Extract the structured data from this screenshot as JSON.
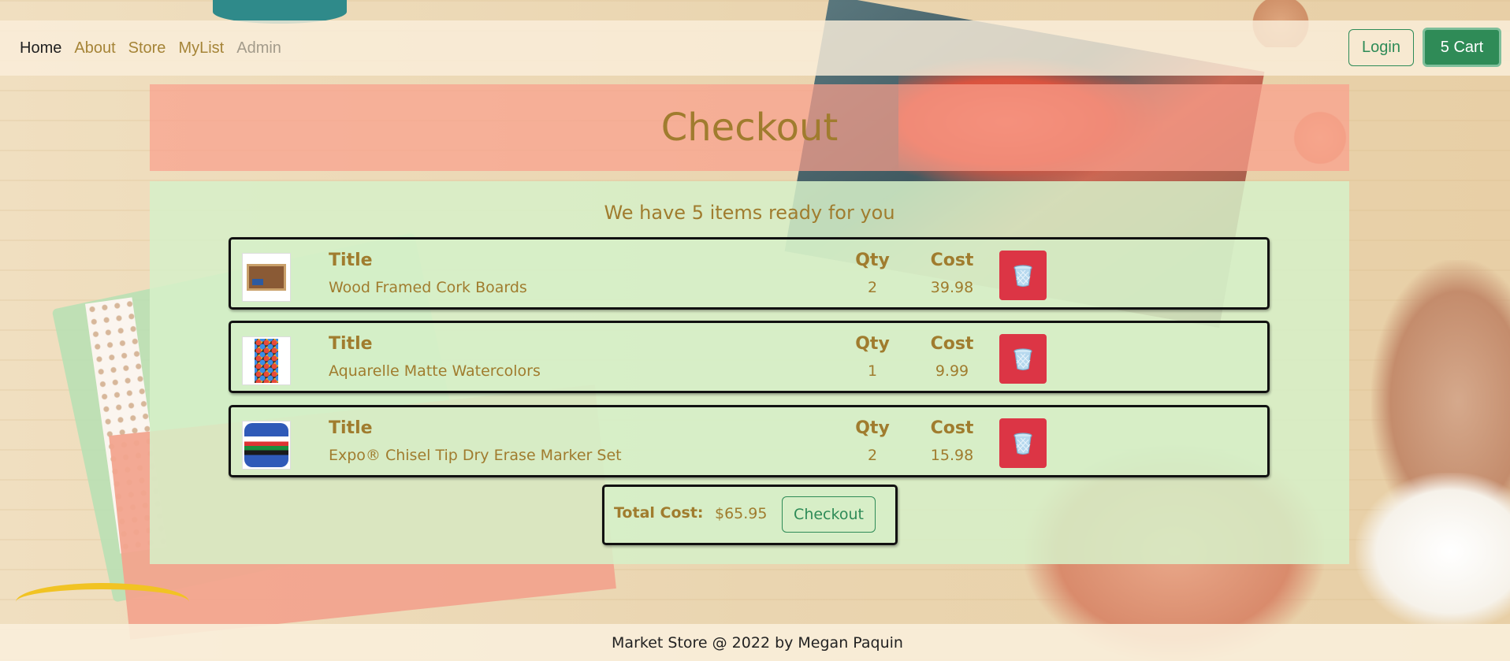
{
  "nav": {
    "links": [
      "Home",
      "About",
      "Store",
      "MyList",
      "Admin"
    ],
    "login_label": "Login",
    "cart_label": "5 Cart"
  },
  "header": {
    "title": "Checkout"
  },
  "checkout": {
    "summary": "We have 5 items ready for you",
    "column_labels": {
      "title": "Title",
      "qty": "Qty",
      "cost": "Cost"
    },
    "items": [
      {
        "title": "Wood Framed Cork Boards",
        "qty": "2",
        "cost": "39.98",
        "thumb": "cork-board-image"
      },
      {
        "title": "Aquarelle Matte Watercolors",
        "qty": "1",
        "cost": "9.99",
        "thumb": "watercolor-set-image"
      },
      {
        "title": "Expo® Chisel Tip Dry Erase Marker Set",
        "qty": "2",
        "cost": "15.98",
        "thumb": "marker-set-image"
      }
    ],
    "total_label": "Total Cost:",
    "total_value": "$65.95",
    "checkout_label": "Checkout"
  },
  "footer": {
    "text": "Market Store @ 2022 by Megan Paquin"
  },
  "colors": {
    "accent_gold": "#a07c2e",
    "success_green": "#2e8b57",
    "danger_red": "#dc3545",
    "panel_green": "#d6f0c8",
    "header_salmon": "#faa08c"
  }
}
